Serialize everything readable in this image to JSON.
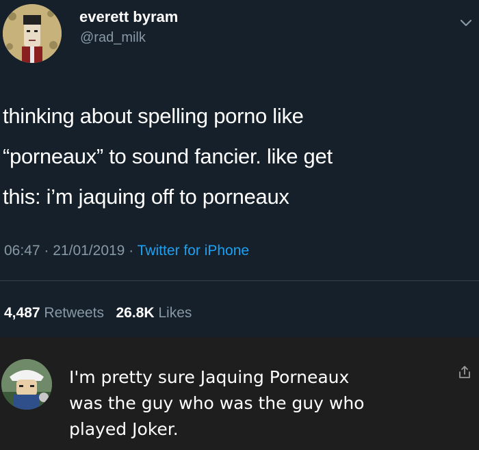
{
  "tweet": {
    "display_name": "everett byram",
    "handle": "@rad_milk",
    "text_lines": [
      "thinking about spelling porno like",
      "“porneaux” to sound fancier. like get",
      "this: i’m jaquing off to porneaux"
    ],
    "time": "06:47",
    "date": "21/01/2019",
    "separator": "·",
    "source": "Twitter for iPhone",
    "retweets_count": "4,487",
    "retweets_label": "Retweets",
    "likes_count": "26.8K",
    "likes_label": "Likes"
  },
  "reply": {
    "text_lines": [
      "I'm pretty sure Jaquing Porneaux",
      "was the guy who was the guy who",
      "played Joker."
    ]
  },
  "icons": {
    "more": "chevron-down-icon",
    "share": "share-icon"
  },
  "colors": {
    "tweet_bg": "#15202b",
    "reply_bg": "#1e1e1e",
    "secondary_text": "#8899a6",
    "link": "#1da1f2"
  }
}
